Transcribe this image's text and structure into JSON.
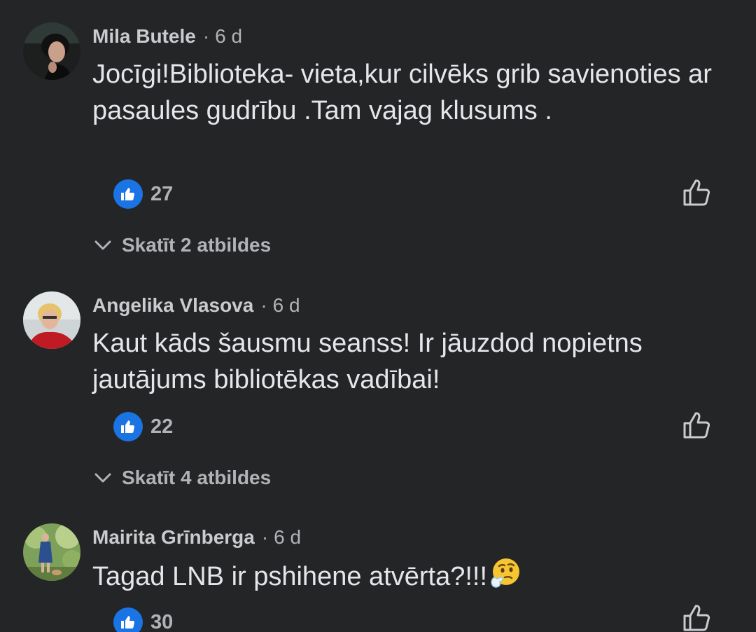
{
  "colors": {
    "background": "#242526",
    "text_primary": "#e4e6eb",
    "text_secondary": "#b0b3b8",
    "like_blue": "#1b74e4"
  },
  "icons": {
    "reaction_badge": "thumbs-up-icon",
    "like_action": "thumbs-up-outline-icon",
    "replies_toggle": "chevron-down-icon",
    "emoji": "thinking-face-icon"
  },
  "comments": [
    {
      "author": "Mila Butele",
      "separator": "·",
      "time": "6 d",
      "text": "Jocīgi!Biblioteka- vieta,kur cilvēks grib savienoties ar pasaules gudrību .Tam vajag klusums .",
      "likes": "27",
      "replies_label": "Skatīt 2 atbildes"
    },
    {
      "author": "Angelika Vlasova",
      "separator": "·",
      "time": "6 d",
      "text": "Kaut kāds šausmu seanss! Ir jāuzdod nopietns jautājums bibliotēkas vadībai!",
      "likes": "22",
      "replies_label": "Skatīt 4 atbildes"
    },
    {
      "author": "Mairita Grīnberga",
      "separator": "·",
      "time": "6 d",
      "text": "Tagad LNB ir pshihene atvērta?!!!",
      "likes": "30"
    }
  ]
}
